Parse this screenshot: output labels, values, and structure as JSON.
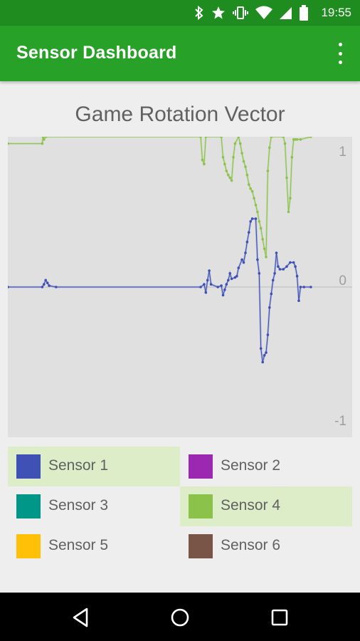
{
  "status_bar": {
    "time": "19:55",
    "icons": [
      "bluetooth-icon",
      "star-icon",
      "vibrate-icon",
      "wifi-icon",
      "signal-icon",
      "battery-icon"
    ]
  },
  "app_bar": {
    "title": "Sensor Dashboard",
    "menu_icon": "overflow-menu-icon"
  },
  "chart_title": "Game Rotation Vector",
  "chart_data": {
    "type": "line",
    "title": "Game Rotation Vector",
    "ylim": [
      -1.1,
      1.1
    ],
    "y_ticks": [
      "1",
      "0",
      "-1"
    ],
    "x_range": [
      0,
      100
    ],
    "grid": "horizontal line at 0",
    "series": [
      {
        "name": "Sensor 1",
        "color": "#3F51B5",
        "points": [
          [
            0,
            0
          ],
          [
            10,
            0
          ],
          [
            10.5,
            0.02
          ],
          [
            11,
            0.05
          ],
          [
            11.5,
            0.03
          ],
          [
            12,
            0.01
          ],
          [
            14,
            0
          ],
          [
            56,
            0
          ],
          [
            57,
            0.02
          ],
          [
            57.5,
            -0.04
          ],
          [
            58,
            0.05
          ],
          [
            58.5,
            0.12
          ],
          [
            59,
            0.02
          ],
          [
            61,
            0
          ],
          [
            62,
            0.01
          ],
          [
            62.5,
            -0.06
          ],
          [
            63,
            -0.02
          ],
          [
            63.5,
            0.02
          ],
          [
            64,
            0.05
          ],
          [
            64.5,
            0.1
          ],
          [
            65,
            0.06
          ],
          [
            66,
            0.07
          ],
          [
            66.5,
            0.08
          ],
          [
            67,
            0.14
          ],
          [
            68,
            0.2
          ],
          [
            68.5,
            0.18
          ],
          [
            69,
            0.25
          ],
          [
            69.5,
            0.33
          ],
          [
            70,
            0.4
          ],
          [
            70.5,
            0.48
          ],
          [
            71,
            0.5
          ],
          [
            72,
            0.5
          ],
          [
            72.5,
            0.2
          ],
          [
            73,
            0.1
          ],
          [
            73.5,
            -0.45
          ],
          [
            74,
            -0.55
          ],
          [
            74.5,
            -0.5
          ],
          [
            75,
            -0.48
          ],
          [
            75.5,
            -0.35
          ],
          [
            76,
            -0.15
          ],
          [
            76.5,
            -0.05
          ],
          [
            77,
            0.05
          ],
          [
            77.5,
            0.1
          ],
          [
            78,
            0.25
          ],
          [
            78.5,
            0.15
          ],
          [
            79,
            0.13
          ],
          [
            80,
            0.13
          ],
          [
            81,
            0.15
          ],
          [
            82,
            0.18
          ],
          [
            83,
            0.18
          ],
          [
            83.5,
            0.15
          ],
          [
            84,
            0.08
          ],
          [
            84.5,
            -0.1
          ],
          [
            85,
            0
          ],
          [
            86,
            0
          ],
          [
            88,
            0
          ]
        ]
      },
      {
        "name": "Sensor 4",
        "color": "#8BC34A",
        "points": [
          [
            0,
            1.05
          ],
          [
            10,
            1.05
          ],
          [
            10.2,
            1.1
          ],
          [
            10.5,
            1.08
          ],
          [
            11,
            1.1
          ],
          [
            56,
            1.1
          ],
          [
            56.5,
            0.93
          ],
          [
            57,
            0.9
          ],
          [
            57.5,
            1.1
          ],
          [
            62,
            1.1
          ],
          [
            62.5,
            0.95
          ],
          [
            63,
            0.9
          ],
          [
            63.5,
            0.85
          ],
          [
            64,
            0.82
          ],
          [
            64.5,
            0.8
          ],
          [
            65,
            0.78
          ],
          [
            65.5,
            0.95
          ],
          [
            66,
            1.05
          ],
          [
            67,
            1.1
          ],
          [
            67.5,
            1.05
          ],
          [
            68,
            0.98
          ],
          [
            68.5,
            0.92
          ],
          [
            69,
            0.88
          ],
          [
            69.5,
            0.82
          ],
          [
            70,
            0.75
          ],
          [
            70.5,
            0.72
          ],
          [
            71,
            0.7
          ],
          [
            71.5,
            0.65
          ],
          [
            72,
            0.6
          ],
          [
            72.5,
            0.55
          ],
          [
            73,
            0.48
          ],
          [
            73.5,
            0.43
          ],
          [
            74,
            0.35
          ],
          [
            74.5,
            0.28
          ],
          [
            75,
            0.22
          ],
          [
            75.5,
            0.85
          ],
          [
            76,
            1.02
          ],
          [
            76.5,
            1.1
          ],
          [
            80,
            1.1
          ],
          [
            80.5,
            1.05
          ],
          [
            81,
            0.8
          ],
          [
            81.5,
            0.55
          ],
          [
            82,
            0.65
          ],
          [
            82.5,
            0.95
          ],
          [
            83,
            1.08
          ],
          [
            83.5,
            1.08
          ],
          [
            84,
            1.08
          ],
          [
            85,
            1.08
          ],
          [
            88,
            1.1
          ]
        ]
      }
    ]
  },
  "legend": [
    {
      "label": "Sensor 1",
      "color": "#3F51B5",
      "selected": true
    },
    {
      "label": "Sensor 2",
      "color": "#9C27B0",
      "selected": false
    },
    {
      "label": "Sensor 3",
      "color": "#009688",
      "selected": false
    },
    {
      "label": "Sensor 4",
      "color": "#8BC34A",
      "selected": true
    },
    {
      "label": "Sensor 5",
      "color": "#FFC107",
      "selected": false
    },
    {
      "label": "Sensor 6",
      "color": "#795548",
      "selected": false
    }
  ],
  "nav_bar": {
    "back": "back-icon",
    "home": "home-icon",
    "recents": "recents-icon"
  }
}
